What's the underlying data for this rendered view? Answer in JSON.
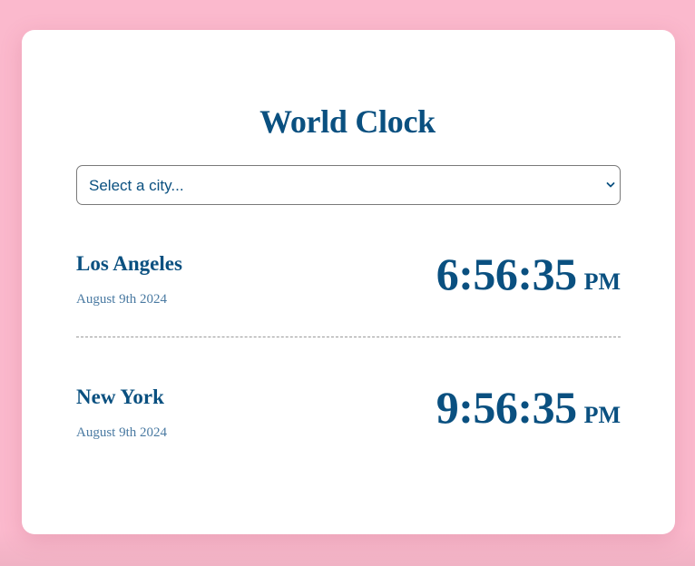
{
  "app": {
    "title": "World Clock"
  },
  "city_select": {
    "selected": "Select a city...",
    "options": [
      "Select a city..."
    ]
  },
  "cities": [
    {
      "name": "Los Angeles",
      "date": "August 9th 2024",
      "time": "6:56:35",
      "period": "PM"
    },
    {
      "name": "New York",
      "date": "August 9th 2024",
      "time": "9:56:35",
      "period": "PM"
    }
  ],
  "colors": {
    "background": "#fbb9cd",
    "card": "#ffffff",
    "primary": "#0a5080",
    "date_text": "#4a7aa2",
    "divider": "#9a9a9a"
  },
  "icons": {
    "select_arrow": "chevron-down-icon"
  }
}
